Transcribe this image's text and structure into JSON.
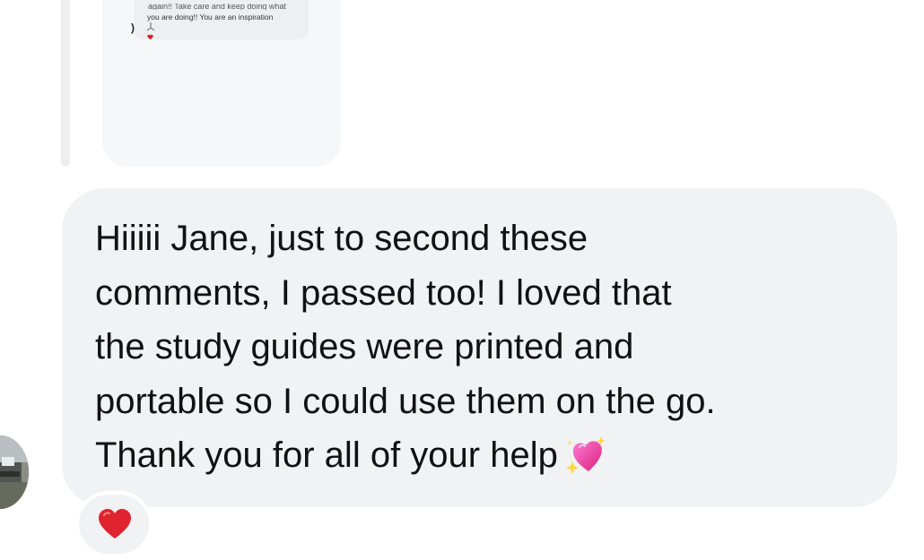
{
  "quoted_message": {
    "line1": "again!! Take care and keep doing what",
    "line2": "you are doing!! You are an inspiration",
    "marker": ")"
  },
  "message": {
    "text": "Hiiiii Jane, just to second these\ncomments, I passed too! I loved that\nthe study guides were printed and\nportable so I could use them on the go.\nThank you for all of your help",
    "emoji_icon": "sparkling-heart-icon"
  },
  "reaction": {
    "icon": "red-heart-icon",
    "color": "#e0232e"
  },
  "colors": {
    "bubble": "#f0f2f4",
    "text": "#111111"
  }
}
